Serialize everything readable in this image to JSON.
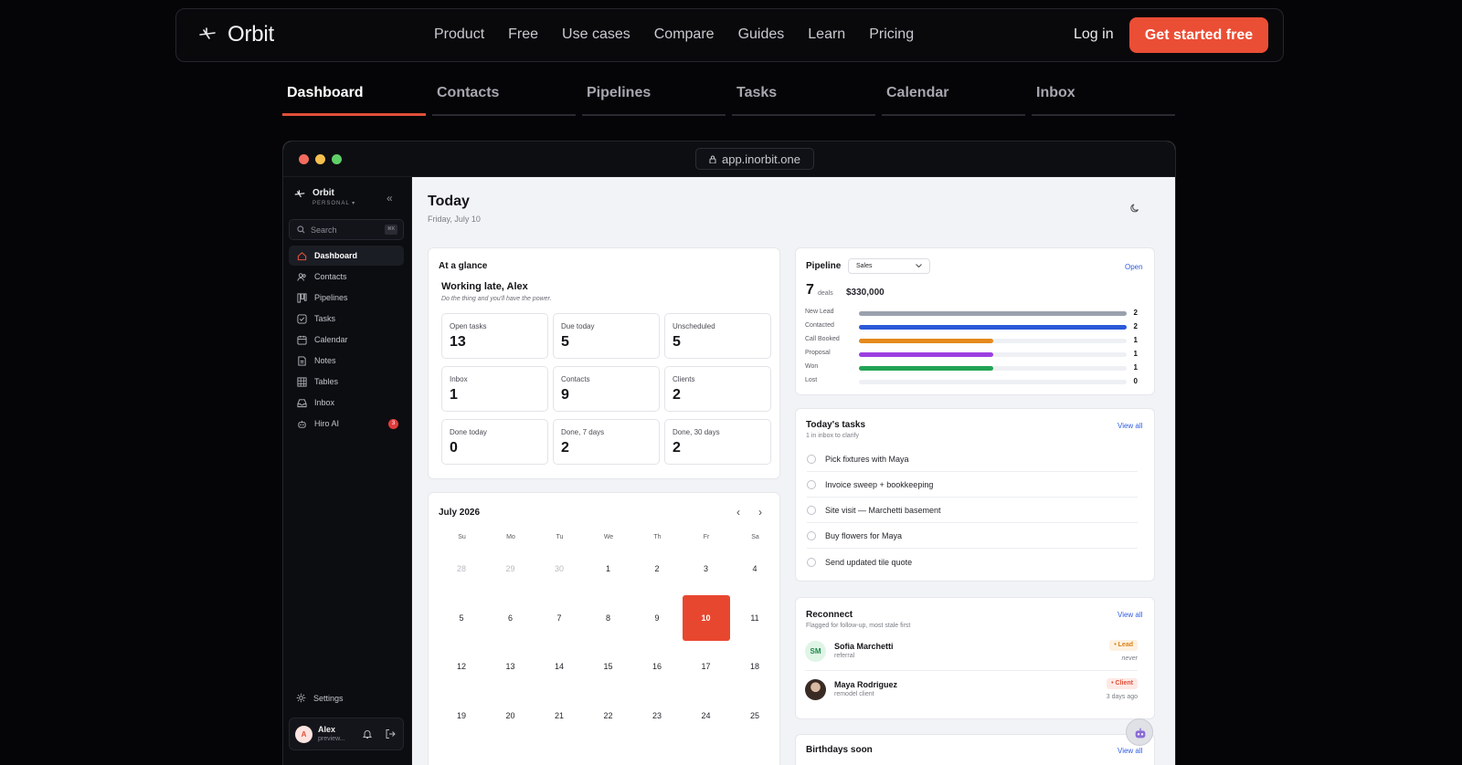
{
  "site": {
    "brand": "Orbit",
    "nav": [
      "Product",
      "Free",
      "Use cases",
      "Compare",
      "Guides",
      "Learn",
      "Pricing"
    ],
    "login": "Log in",
    "cta": "Get started free"
  },
  "tabs": [
    "Dashboard",
    "Contacts",
    "Pipelines",
    "Tasks",
    "Calendar",
    "Inbox"
  ],
  "window": {
    "url": "app.inorbit.one",
    "dot_colors": [
      "#f26b5f",
      "#f5bf4f",
      "#5fd068"
    ]
  },
  "sidebar": {
    "workspace": "Orbit",
    "workspace_sub": "PERSONAL ▾",
    "search_placeholder": "Search",
    "shortcut": "⌘K",
    "items": [
      {
        "label": "Dashboard",
        "icon": "home-icon"
      },
      {
        "label": "Contacts",
        "icon": "users-icon"
      },
      {
        "label": "Pipelines",
        "icon": "kanban-icon"
      },
      {
        "label": "Tasks",
        "icon": "checkbox-icon"
      },
      {
        "label": "Calendar",
        "icon": "calendar-icon"
      },
      {
        "label": "Notes",
        "icon": "note-icon"
      },
      {
        "label": "Tables",
        "icon": "table-icon"
      },
      {
        "label": "Inbox",
        "icon": "inbox-icon"
      },
      {
        "label": "Hiro AI",
        "icon": "robot-icon",
        "badge": "3"
      }
    ],
    "settings": "Settings",
    "user": {
      "initial": "A",
      "name": "Alex",
      "sub": "preview..."
    }
  },
  "main": {
    "title": "Today",
    "date": "Friday, July 10",
    "glance": {
      "title": "At a glance",
      "greeting": "Working late, Alex",
      "quote": "Do the thing and you'll have the power.",
      "stats": [
        {
          "label": "Open tasks",
          "value": "13"
        },
        {
          "label": "Due today",
          "value": "5"
        },
        {
          "label": "Unscheduled",
          "value": "5"
        },
        {
          "label": "Inbox",
          "value": "1"
        },
        {
          "label": "Contacts",
          "value": "9"
        },
        {
          "label": "Clients",
          "value": "2"
        },
        {
          "label": "Done today",
          "value": "0"
        },
        {
          "label": "Done, 7 days",
          "value": "2"
        },
        {
          "label": "Done, 30 days",
          "value": "2"
        }
      ]
    },
    "pipeline": {
      "title": "Pipeline",
      "select": "Sales",
      "open": "Open",
      "deals_count": "7",
      "deals_label": "deals",
      "amount": "$330,000",
      "stages": [
        {
          "name": "New Lead",
          "count": 2,
          "color": "#9aa1ad"
        },
        {
          "name": "Contacted",
          "count": 2,
          "color": "#2b59d9"
        },
        {
          "name": "Call Booked",
          "count": 1,
          "color": "#e48a1d"
        },
        {
          "name": "Proposal",
          "count": 1,
          "color": "#9b3fe0"
        },
        {
          "name": "Won",
          "count": 1,
          "color": "#22a355"
        },
        {
          "name": "Lost",
          "count": 0,
          "color": "#c9ccd3"
        }
      ],
      "max": 2
    },
    "tasks": {
      "title": "Today's tasks",
      "sub": "1 in inbox to clarify",
      "view_all": "View all",
      "items": [
        "Pick fixtures with Maya",
        "Invoice sweep + bookkeeping",
        "Site visit — Marchetti basement",
        "Buy flowers for Maya",
        "Send updated tile quote"
      ]
    },
    "calendar": {
      "title": "July 2026",
      "prev": "‹",
      "next": "›",
      "dows": [
        "Su",
        "Mo",
        "Tu",
        "We",
        "Th",
        "Fr",
        "Sa"
      ],
      "weeks": [
        [
          "28",
          "29",
          "30",
          "1",
          "2",
          "3",
          "4"
        ],
        [
          "5",
          "6",
          "7",
          "8",
          "9",
          "10",
          "11"
        ],
        [
          "12",
          "13",
          "14",
          "15",
          "16",
          "17",
          "18"
        ],
        [
          "19",
          "20",
          "21",
          "22",
          "23",
          "24",
          "25"
        ]
      ],
      "muted": [
        "28",
        "29",
        "30"
      ],
      "today": "10"
    },
    "reconnect": {
      "title": "Reconnect",
      "sub": "Flagged for follow-up, most stale first",
      "view_all": "View all",
      "contacts": [
        {
          "initials": "SM",
          "name": "Sofia Marchetti",
          "sub": "referral",
          "tag": "• Lead",
          "when": "never",
          "tag_color": "#d9821a",
          "tag_bg": "#fdf1e1"
        },
        {
          "initials": "",
          "name": "Maya Rodriguez",
          "sub": "remodel client",
          "tag": "• Client",
          "when": "3 days ago",
          "tag_color": "#e0503a",
          "tag_bg": "#fde9e5"
        }
      ]
    },
    "birthdays": {
      "title": "Birthdays soon",
      "view_all": "View all"
    }
  }
}
